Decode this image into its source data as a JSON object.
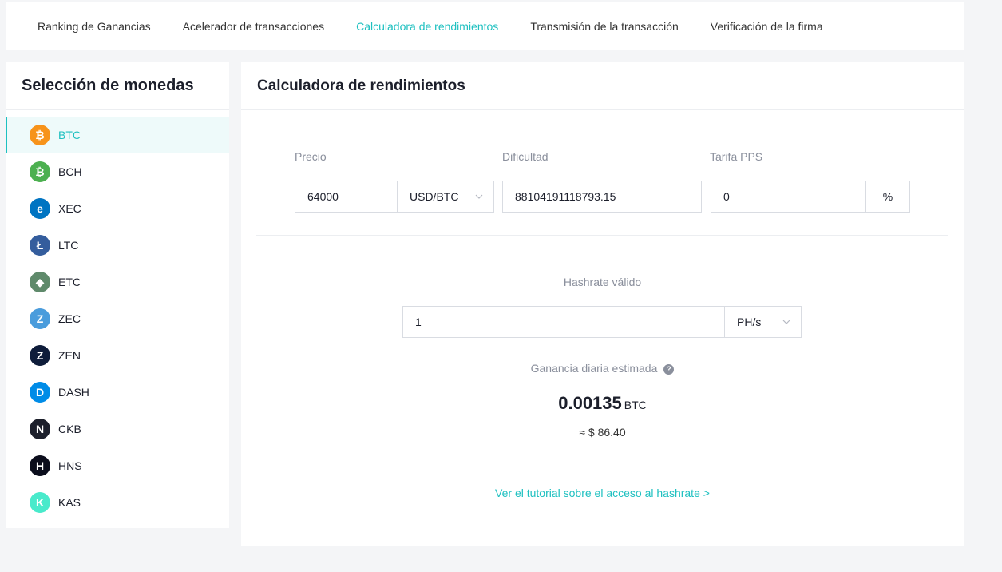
{
  "nav": {
    "tabs": [
      {
        "label": "Ranking de Ganancias"
      },
      {
        "label": "Acelerador de transacciones"
      },
      {
        "label": "Calculadora de rendimientos"
      },
      {
        "label": "Transmisión de la transacción"
      },
      {
        "label": "Verificación de la firma"
      }
    ],
    "active_index": 2
  },
  "sidebar": {
    "title": "Selección de monedas",
    "coins": [
      {
        "label": "BTC",
        "icon": "btc-icon",
        "color": "#f7931a",
        "glyph": "₿"
      },
      {
        "label": "BCH",
        "icon": "bch-icon",
        "color": "#4cb050",
        "glyph": "₿"
      },
      {
        "label": "XEC",
        "icon": "xec-icon",
        "color": "#0074c2",
        "glyph": "e"
      },
      {
        "label": "LTC",
        "icon": "ltc-icon",
        "color": "#345d9d",
        "glyph": "Ł"
      },
      {
        "label": "ETC",
        "icon": "etc-icon",
        "color": "#5f8a6b",
        "glyph": "◆"
      },
      {
        "label": "ZEC",
        "icon": "zec-icon",
        "color": "#4a9cdc",
        "glyph": "Z"
      },
      {
        "label": "ZEN",
        "icon": "zen-icon",
        "color": "#0e1c3a",
        "glyph": "Z"
      },
      {
        "label": "DASH",
        "icon": "dash-icon",
        "color": "#008ce7",
        "glyph": "D"
      },
      {
        "label": "CKB",
        "icon": "ckb-icon",
        "color": "#1c1f2b",
        "glyph": "N"
      },
      {
        "label": "HNS",
        "icon": "hns-icon",
        "color": "#0b0d1c",
        "glyph": "H"
      },
      {
        "label": "KAS",
        "icon": "kas-icon",
        "color": "#49eacb",
        "glyph": "K"
      }
    ],
    "active_index": 0
  },
  "main": {
    "title": "Calculadora de rendimientos",
    "price": {
      "label": "Precio",
      "value": "64000",
      "unit": "USD/BTC"
    },
    "difficulty": {
      "label": "Dificultad",
      "value": "88104191118793.15"
    },
    "pps": {
      "label": "Tarifa PPS",
      "value": "0",
      "unit": "%"
    },
    "hashrate": {
      "label": "Hashrate válido",
      "value": "1",
      "unit": "PH/s"
    },
    "earnings": {
      "label": "Ganancia diaria estimada",
      "help": "?",
      "amount": "0.00135",
      "unit": "BTC",
      "approx": "≈ $ 86.40"
    },
    "tutorial_link": "Ver el tutorial sobre el acceso al hashrate >"
  },
  "colors": {
    "accent": "#1ec0c0",
    "text": "#1c1f2b",
    "muted": "#8a8f9c"
  }
}
